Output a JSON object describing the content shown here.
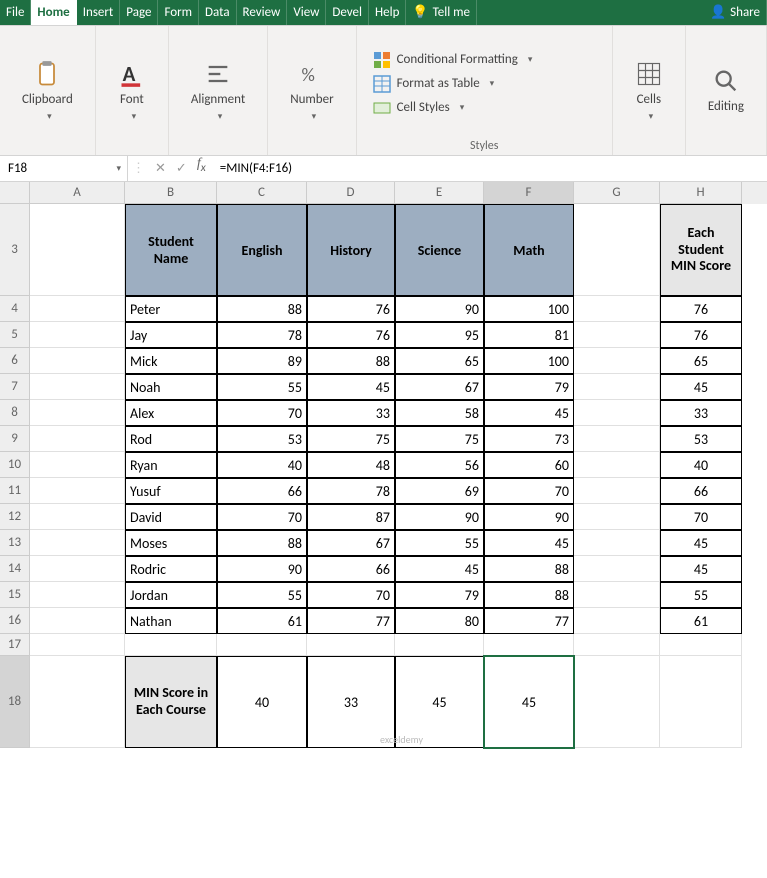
{
  "tabs": {
    "file": "File",
    "home": "Home",
    "insert": "Insert",
    "page": "Page",
    "form": "Form",
    "data": "Data",
    "review": "Review",
    "view": "View",
    "devel": "Devel",
    "help": "Help",
    "tellme": "Tell me",
    "share": "Share"
  },
  "ribbon": {
    "clipboard": "Clipboard",
    "font": "Font",
    "alignment": "Alignment",
    "number": "Number",
    "styles": "Styles",
    "cells": "Cells",
    "editing": "Editing",
    "cond_format": "Conditional Formatting",
    "format_table": "Format as Table",
    "cell_styles": "Cell Styles"
  },
  "name_box": "F18",
  "formula": "=MIN(F4:F16)",
  "columns": [
    "A",
    "B",
    "C",
    "D",
    "E",
    "F",
    "G",
    "H"
  ],
  "visible_row_header": "3",
  "headers": {
    "student_name": "Student Name",
    "english": "English",
    "history": "History",
    "science": "Science",
    "math": "Math",
    "each_min": "Each Student MIN Score",
    "min_course": "MIN Score in Each Course"
  },
  "rows": [
    {
      "n": 4,
      "name": "Peter",
      "eng": 88,
      "his": 76,
      "sci": 90,
      "math": 100,
      "min": 76
    },
    {
      "n": 5,
      "name": "Jay",
      "eng": 78,
      "his": 76,
      "sci": 95,
      "math": 81,
      "min": 76
    },
    {
      "n": 6,
      "name": "Mick",
      "eng": 89,
      "his": 88,
      "sci": 65,
      "math": 100,
      "min": 65
    },
    {
      "n": 7,
      "name": "Noah",
      "eng": 55,
      "his": 45,
      "sci": 67,
      "math": 79,
      "min": 45
    },
    {
      "n": 8,
      "name": "Alex",
      "eng": 70,
      "his": 33,
      "sci": 58,
      "math": 45,
      "min": 33
    },
    {
      "n": 9,
      "name": "Rod",
      "eng": 53,
      "his": 75,
      "sci": 75,
      "math": 73,
      "min": 53
    },
    {
      "n": 10,
      "name": "Ryan",
      "eng": 40,
      "his": 48,
      "sci": 56,
      "math": 60,
      "min": 40
    },
    {
      "n": 11,
      "name": "Yusuf",
      "eng": 66,
      "his": 78,
      "sci": 69,
      "math": 70,
      "min": 66
    },
    {
      "n": 12,
      "name": "David",
      "eng": 70,
      "his": 87,
      "sci": 90,
      "math": 90,
      "min": 70
    },
    {
      "n": 13,
      "name": "Moses",
      "eng": 88,
      "his": 67,
      "sci": 55,
      "math": 45,
      "min": 45
    },
    {
      "n": 14,
      "name": "Rodric",
      "eng": 90,
      "his": 66,
      "sci": 45,
      "math": 88,
      "min": 45
    },
    {
      "n": 15,
      "name": "Jordan",
      "eng": 55,
      "his": 70,
      "sci": 79,
      "math": 88,
      "min": 55
    },
    {
      "n": 16,
      "name": "Nathan",
      "eng": 61,
      "his": 77,
      "sci": 80,
      "math": 77,
      "min": 61
    }
  ],
  "min_row": {
    "n": 18,
    "eng": 40,
    "his": 33,
    "sci": 45,
    "math": 45
  },
  "empty_row_n": 17,
  "watermark": "exceldemy"
}
